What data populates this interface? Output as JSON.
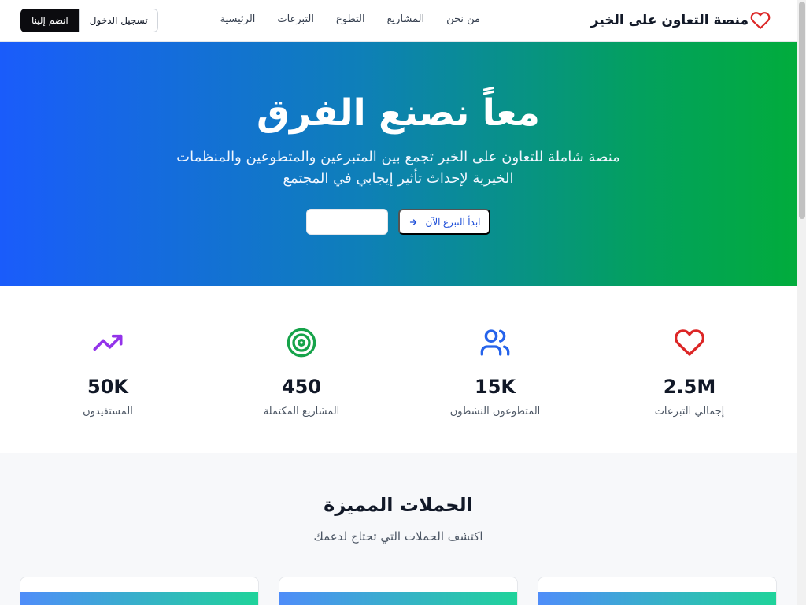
{
  "header": {
    "brand": "منصة التعاون على الخير",
    "brand_icon": "heart-icon",
    "nav": [
      "الرئيسية",
      "التبرعات",
      "التطوع",
      "المشاريع",
      "من نحن"
    ],
    "login_label": "تسجيل الدخول",
    "join_label": "انضم إلينا"
  },
  "hero": {
    "title": "معاً نصنع الفرق",
    "subtitle": "منصة شاملة للتعاون على الخير تجمع بين المتبرعين والمتطوعين والمنظمات الخيرية لإحداث تأثير إيجابي في المجتمع",
    "donate_label": "ابدأ التبرع الآن",
    "donate_icon": "arrow-right-icon"
  },
  "stats": [
    {
      "value": "2.5M",
      "label": "إجمالي التبرعات",
      "icon": "heart-icon",
      "color": "#dc2626"
    },
    {
      "value": "15K",
      "label": "المتطوعون النشطون",
      "icon": "users-icon",
      "color": "#2563eb"
    },
    {
      "value": "450",
      "label": "المشاريع المكتملة",
      "icon": "target-icon",
      "color": "#16a34a"
    },
    {
      "value": "50K",
      "label": "المستفيدون",
      "icon": "trending-up-icon",
      "color": "#9333ea"
    }
  ],
  "campaigns": {
    "title": "الحملات المميزة",
    "subtitle": "اكتشف الحملات التي تحتاج لدعمك"
  },
  "colors": {
    "hero_start": "#1a5cfb",
    "hero_end": "#01ac3c",
    "primary": "#1d4ed8"
  }
}
